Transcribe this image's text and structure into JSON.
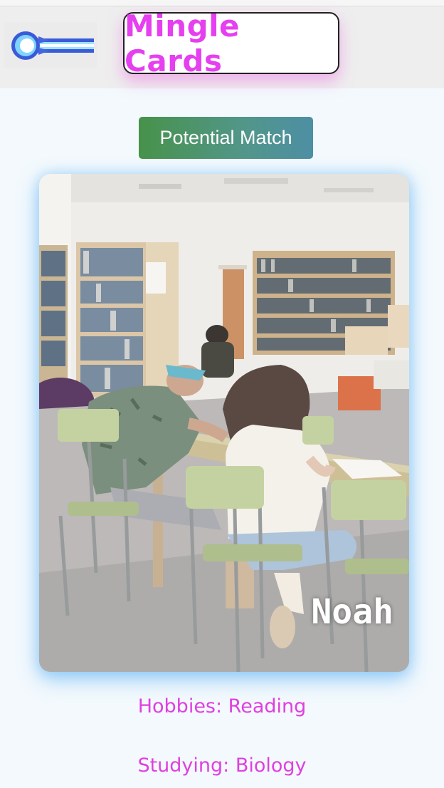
{
  "header": {
    "back_icon": "comet-arrow-icon",
    "title": "Mingle Cards"
  },
  "badge": {
    "label": "Potential Match"
  },
  "profile": {
    "name": "Noah",
    "photo_subject": "students studying in library",
    "hobbies": "Hobbies: Reading",
    "studying": "Studying: Biology"
  },
  "colors": {
    "accent": "#e63ff0",
    "badge_start": "#47924a",
    "badge_end": "#4d8fa4",
    "card_glow": "#78bef5"
  }
}
